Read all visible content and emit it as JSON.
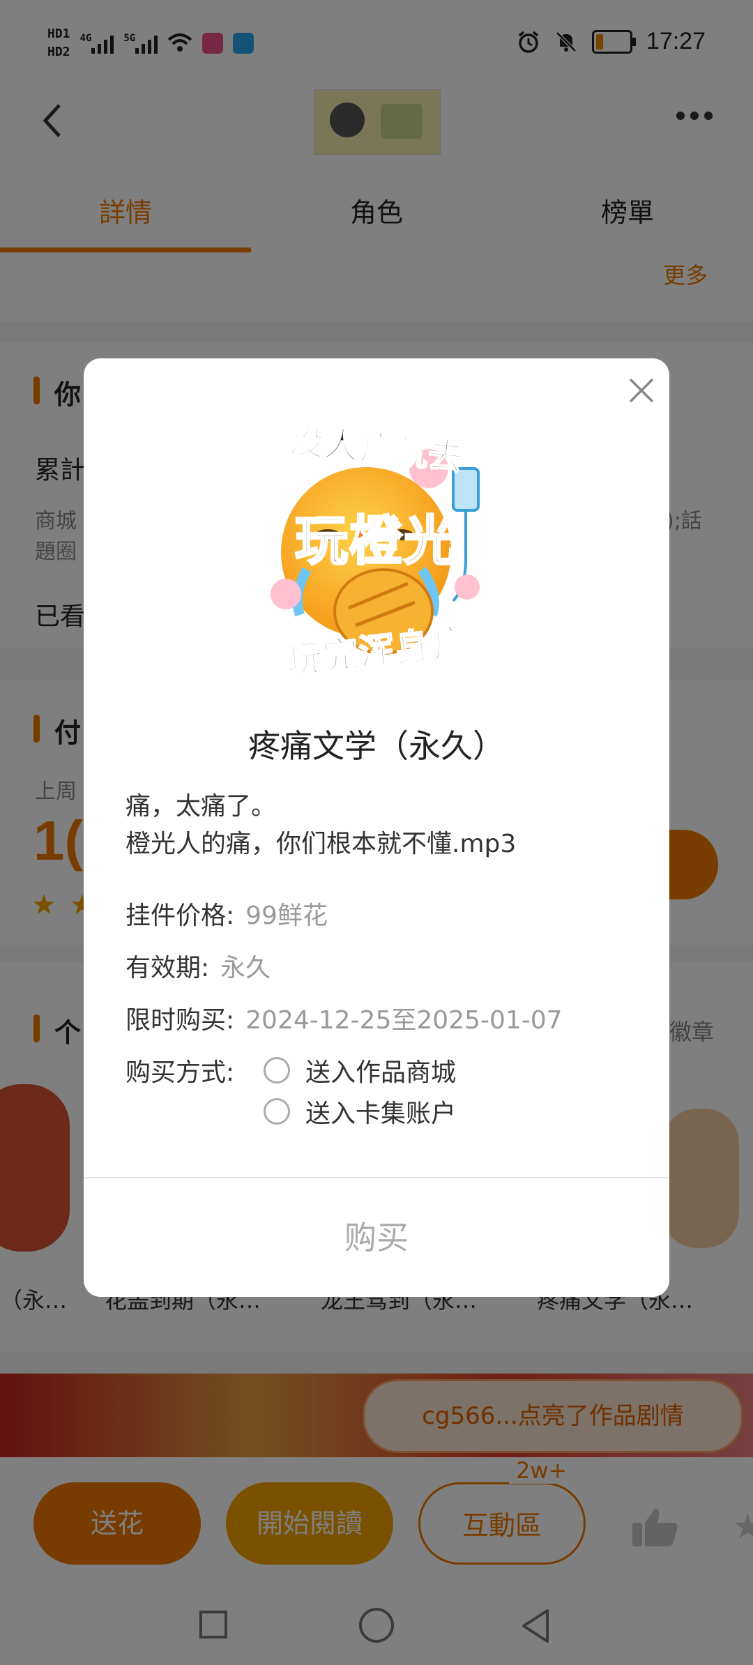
{
  "status_bar": {
    "hd1": "HD1",
    "hd2": "HD2",
    "net1": "4G",
    "net2": "5G",
    "time": "17:27",
    "battery_level": 0.25
  },
  "header": {
    "tabs": [
      "詳情",
      "角色",
      "榜單"
    ],
    "active_tab_index": 0,
    "more_link": "更多"
  },
  "background": {
    "section1_title": "你",
    "line_a": "累計",
    "line_b": "商城",
    "line_b2": "題圈",
    "line_b_tail": ");話",
    "line_c": "已看",
    "section2_title": "付",
    "section2_sub": "上周",
    "big_number": "1(",
    "section3_title": "个",
    "badge_link": "徽章",
    "item_labels": [
      "（永…",
      "花盖到期（永…",
      "龙王驾到（永…",
      "疼痛文学（永…"
    ]
  },
  "toast": "cg566...点亮了作品剧情",
  "bottom_bar": {
    "send_flower": "送花",
    "start_read": "開始閱讀",
    "interaction": "互動區",
    "interaction_count": "2w+"
  },
  "dialog": {
    "sticker_text_top": "没人疼就去",
    "sticker_text_mid_a": "玩",
    "sticker_text_mid_b": "橙光",
    "sticker_text_bottom": "玩完浑身疼",
    "title": "疼痛文学（永久）",
    "description": "痛，太痛了。\n橙光人的痛，你们根本就不懂.mp3",
    "price_label": "挂件价格:",
    "price_value": "99鲜花",
    "validity_label": "有效期:",
    "validity_value": "永久",
    "limited_label": "限时购买:",
    "limited_value": "2024-12-25至2025-01-07",
    "method_label": "购买方式:",
    "options": [
      "送入作品商城",
      "送入卡集账户"
    ],
    "buy_button": "购买"
  }
}
